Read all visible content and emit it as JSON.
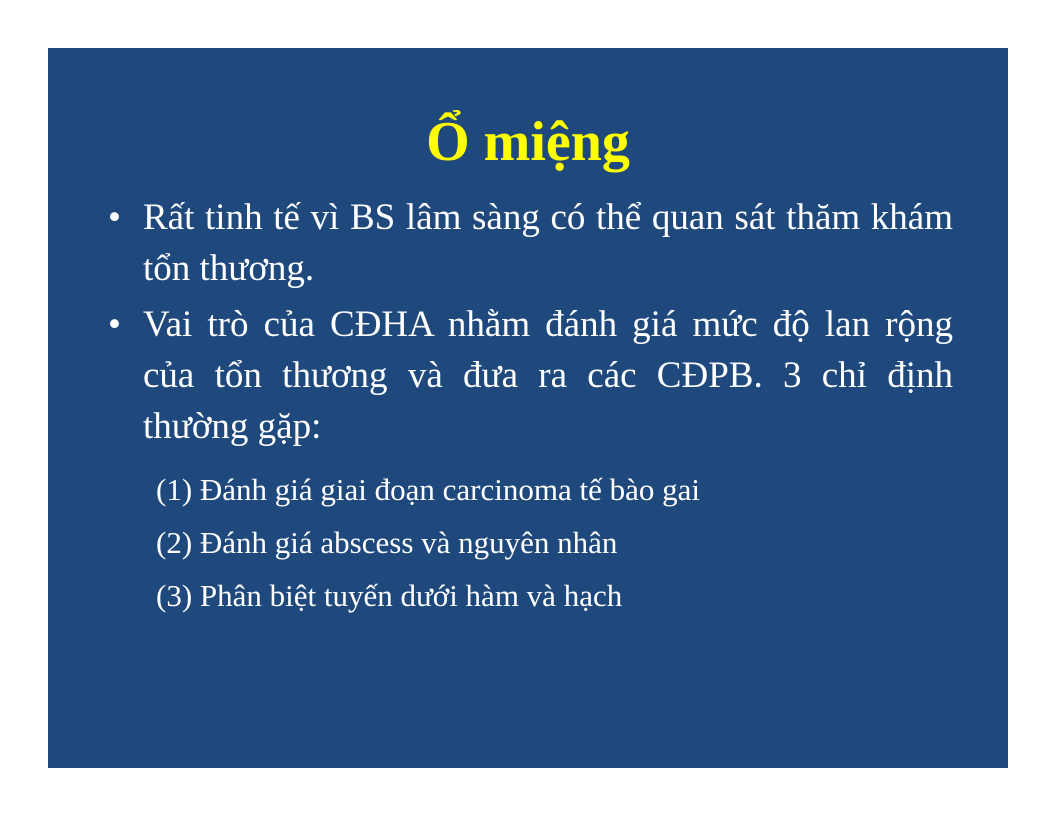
{
  "slide": {
    "title": "Ổ miệng",
    "bullets": [
      {
        "marker": "•",
        "text": "Rất tinh tế vì BS lâm sàng có thể quan sát thăm khám tổn thương."
      },
      {
        "marker": "•",
        "text": "Vai trò của CĐHA nhằm đánh giá mức độ lan rộng của tổn thương và đưa ra các CĐPB. 3 chỉ định thường gặp:"
      }
    ],
    "subitems": [
      "(1) Đánh giá giai đoạn carcinoma tế bào gai",
      "(2) Đánh giá abscess và nguyên nhân",
      "(3) Phân biệt tuyến dưới hàm và hạch"
    ]
  },
  "colors": {
    "background": "#1f497d",
    "title": "#ffff00",
    "body_text": "#ffffff",
    "page": "#ffffff"
  }
}
